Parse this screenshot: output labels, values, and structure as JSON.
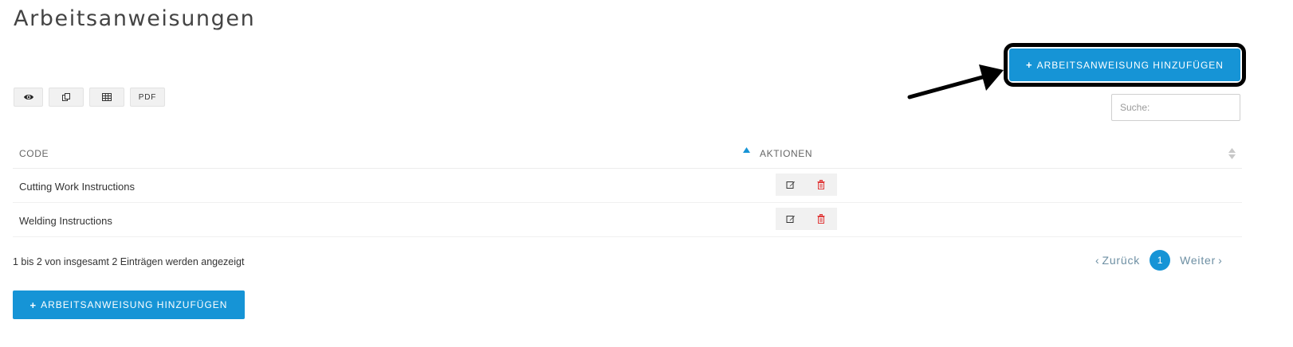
{
  "header": {
    "title": "Arbeitsanweisungen"
  },
  "toolbar": {
    "buttons": [
      {
        "icon": "eye-icon",
        "label": ""
      },
      {
        "icon": "copy-icon",
        "label": ""
      },
      {
        "icon": "table-icon",
        "label": ""
      },
      {
        "icon": "",
        "label": "PDF"
      }
    ]
  },
  "add_button": {
    "icon": "+",
    "label": "ARBEITSANWEISUNG HINZUFÜGEN"
  },
  "search": {
    "placeholder": "Suche:"
  },
  "table": {
    "columns": [
      "CODE",
      "AKTIONEN"
    ],
    "rows": [
      {
        "code": "Cutting Work Instructions"
      },
      {
        "code": "Welding Instructions"
      }
    ],
    "sort": {
      "column": "CODE",
      "direction": "ascending"
    }
  },
  "footer": {
    "info": "1 bis 2 von insgesamt 2 Einträgen werden angezeigt",
    "pagination": {
      "prev": "Zurück",
      "current": "1",
      "next": "Weiter"
    }
  },
  "colors": {
    "accent": "#1694d6",
    "delete": "#e03b3b",
    "annotation": "#000000"
  }
}
